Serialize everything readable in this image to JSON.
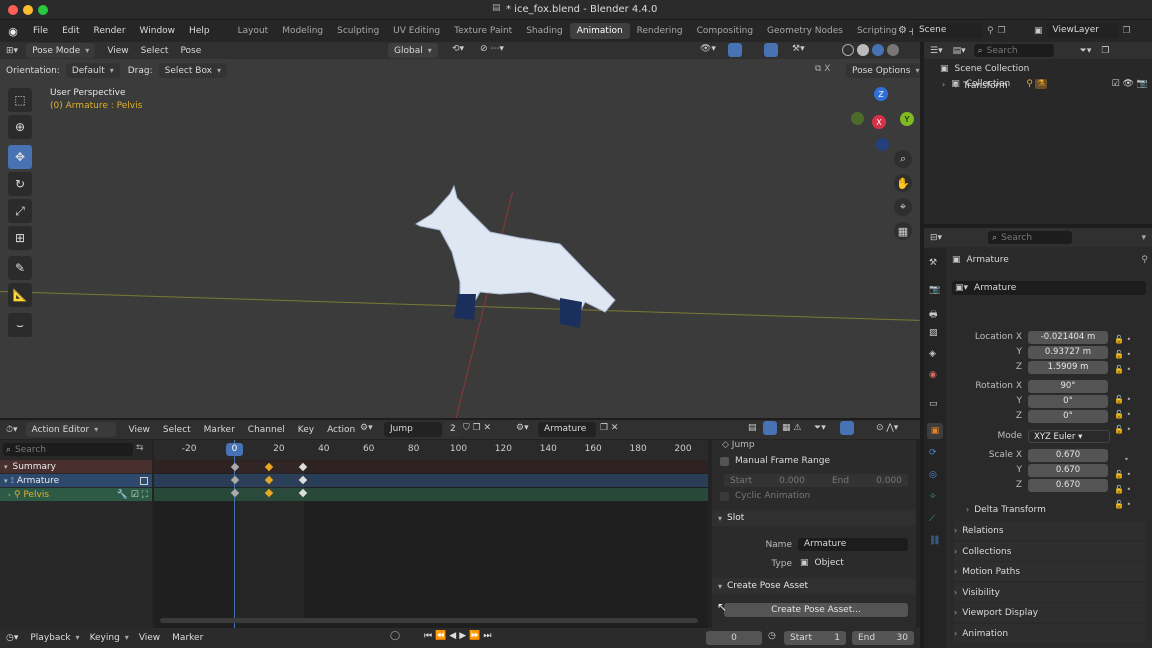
{
  "window": {
    "title": "* ice_fox.blend - Blender 4.4.0"
  },
  "menu": {
    "items": [
      "File",
      "Edit",
      "Render",
      "Window",
      "Help"
    ]
  },
  "workspaces": [
    "Layout",
    "Modeling",
    "Sculpting",
    "UV Editing",
    "Texture Paint",
    "Shading",
    "Animation",
    "Rendering",
    "Compositing",
    "Geometry Nodes",
    "Scripting"
  ],
  "active_workspace": "Animation",
  "scene": {
    "label": "Scene",
    "view_layer": "ViewLayer"
  },
  "viewport": {
    "mode": "Pose Mode",
    "menus": [
      "View",
      "Select",
      "Pose"
    ],
    "orientation_label": "Orientation:",
    "orientation_value": "Default",
    "drag_label": "Drag:",
    "drag_value": "Select Box",
    "transform_orientation": "Global",
    "pose_options": "Pose Options",
    "perspective": "User Perspective",
    "object_info": "(0) Armature : Pelvis",
    "gizmo": {
      "z": "Z",
      "x": "X",
      "y": "Y"
    }
  },
  "dopesheet": {
    "editor": "Action Editor",
    "menus": [
      "View",
      "Select",
      "Marker",
      "Channel",
      "Key",
      "Action"
    ],
    "action": "Jump",
    "users": "2",
    "slot": "Armature",
    "search_placeholder": "Search",
    "ticks": [
      "-20",
      "0",
      "20",
      "40",
      "60",
      "80",
      "100",
      "120",
      "140",
      "160",
      "180",
      "200"
    ],
    "current_frame": "0",
    "channels": [
      {
        "name": "Summary"
      },
      {
        "name": "Armature"
      },
      {
        "name": "Pelvis"
      }
    ]
  },
  "action_panel": {
    "jump_label": "Jump",
    "manual_frame_range": "Manual Frame Range",
    "start_label": "Start",
    "start_value": "0.000",
    "end_label": "End",
    "end_value": "0.000",
    "cyclic": "Cyclic Animation",
    "slot_title": "Slot",
    "name_label": "Name",
    "name_value": "Armature",
    "type_label": "Type",
    "type_value": "Object",
    "pose_asset_title": "Create Pose Asset",
    "pose_asset_button": "Create Pose Asset..."
  },
  "timeline": {
    "playback": "Playback",
    "keying": "Keying",
    "view": "View",
    "marker": "Marker",
    "frame": "0",
    "start_label": "Start",
    "start_value": "1",
    "end_label": "End",
    "end_value": "30"
  },
  "outliner": {
    "search_placeholder": "Search",
    "scene_collection": "Scene Collection",
    "collection": "Collection"
  },
  "properties": {
    "search_placeholder": "Search",
    "object_name": "Armature",
    "datablock": "Armature",
    "transform": "Transform",
    "location_label": "Location X",
    "location": [
      "-0.021404 m",
      "0.93727 m",
      "1.5909 m"
    ],
    "rotation_label": "Rotation X",
    "rotation": [
      "90°",
      "0°",
      "0°"
    ],
    "mode_label": "Mode",
    "mode_value": "XYZ Euler",
    "scale_label": "Scale X",
    "scale": [
      "0.670",
      "0.670",
      "0.670"
    ],
    "axis_y": "Y",
    "axis_z": "Z",
    "sections": [
      "Delta Transform",
      "Relations",
      "Collections",
      "Motion Paths",
      "Visibility",
      "Viewport Display",
      "Animation"
    ]
  },
  "colors": {
    "accent": "#4772b3",
    "keyframe": "#e8a825",
    "armature_row": "#2d4a6e",
    "pelvis_row": "#2c5a45",
    "summary_row": "#3a2b2b"
  }
}
